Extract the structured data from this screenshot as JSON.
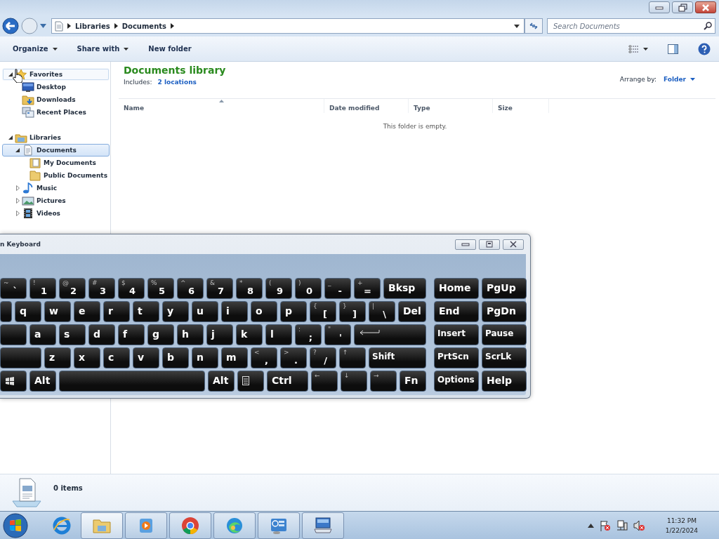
{
  "explorer": {
    "address": {
      "breadcrumbs": [
        "Libraries",
        "Documents"
      ]
    },
    "search": {
      "placeholder": "Search Documents"
    },
    "toolbar": [
      {
        "label": "Organize",
        "menu": true
      },
      {
        "label": "Share with",
        "menu": true
      },
      {
        "label": "New folder",
        "menu": false
      }
    ],
    "tree": [
      {
        "label": "Favorites",
        "expanded": true,
        "selected": false,
        "hovered": true,
        "children": [
          {
            "label": "Desktop",
            "selected": false,
            "hovered": false
          },
          {
            "label": "Downloads",
            "selected": false,
            "hovered": false
          },
          {
            "label": "Recent Places",
            "selected": false,
            "hovered": false
          }
        ]
      },
      {
        "label": "Libraries",
        "expanded": true,
        "selected": false,
        "hovered": false,
        "children": [
          {
            "label": "Documents",
            "expanded": true,
            "selected": true,
            "hovered": false,
            "children": [
              {
                "label": "My Documents",
                "selected": false,
                "hovered": false
              },
              {
                "label": "Public Documents",
                "selected": false,
                "hovered": false
              }
            ]
          },
          {
            "label": "Music",
            "expanded": false,
            "selected": false,
            "hovered": false
          },
          {
            "label": "Pictures",
            "expanded": false,
            "selected": false,
            "hovered": false
          },
          {
            "label": "Videos",
            "expanded": false,
            "selected": false,
            "hovered": false
          }
        ]
      }
    ],
    "library": {
      "title": "Documents library",
      "includes_label": "Includes:",
      "locations": "2 locations",
      "arrange_label": "Arrange by:",
      "arrange_value": "Folder"
    },
    "columns": [
      "Name",
      "Date modified",
      "Type",
      "Size"
    ],
    "empty_message": "This folder is empty.",
    "status_bar": {
      "item_count": "0 items"
    }
  },
  "keyboard": {
    "title": "n Keyboard",
    "rows": [
      {
        "keys": [
          {
            "label": "`",
            "shift": "~"
          },
          {
            "label": "1",
            "shift": "!"
          },
          {
            "label": "2",
            "shift": "@"
          },
          {
            "label": "3",
            "shift": "#"
          },
          {
            "label": "4",
            "shift": "$"
          },
          {
            "label": "5",
            "shift": "%"
          },
          {
            "label": "6",
            "shift": "^"
          },
          {
            "label": "7",
            "shift": "&"
          },
          {
            "label": "8",
            "shift": "*"
          },
          {
            "label": "9",
            "shift": "("
          },
          {
            "label": "0",
            "shift": ")"
          },
          {
            "label": "-",
            "shift": "_"
          },
          {
            "label": "=",
            "shift": "+"
          },
          {
            "label": "Bksp"
          }
        ],
        "nav_keys": [
          {
            "label": "Home"
          },
          {
            "label": "PgUp"
          }
        ]
      },
      {
        "keys": [
          {
            "kind": "blank"
          },
          {
            "label": "q"
          },
          {
            "label": "w"
          },
          {
            "label": "e"
          },
          {
            "label": "r"
          },
          {
            "label": "t"
          },
          {
            "label": "y"
          },
          {
            "label": "u"
          },
          {
            "label": "i"
          },
          {
            "label": "o"
          },
          {
            "label": "p"
          },
          {
            "label": "[",
            "shift": "{"
          },
          {
            "label": "]",
            "shift": "}"
          },
          {
            "label": "\\",
            "shift": "|"
          },
          {
            "label": "Del"
          }
        ],
        "nav_keys": [
          {
            "label": "End"
          },
          {
            "label": "PgDn"
          }
        ]
      },
      {
        "keys": [
          {
            "kind": "blank"
          },
          {
            "label": "a"
          },
          {
            "label": "s"
          },
          {
            "label": "d"
          },
          {
            "label": "f"
          },
          {
            "label": "g"
          },
          {
            "label": "h"
          },
          {
            "label": "j"
          },
          {
            "label": "k"
          },
          {
            "label": "l"
          },
          {
            "label": ";",
            "shift": ":"
          },
          {
            "label": "'",
            "shift": "\""
          },
          {
            "kind": "enter"
          }
        ],
        "nav_keys": [
          {
            "label": "Insert"
          },
          {
            "label": "Pause"
          }
        ]
      },
      {
        "keys": [
          {
            "kind": "blank"
          },
          {
            "label": "z"
          },
          {
            "label": "x"
          },
          {
            "label": "c"
          },
          {
            "label": "v"
          },
          {
            "label": "b"
          },
          {
            "label": "n"
          },
          {
            "label": "m"
          },
          {
            "label": ",",
            "shift": "<"
          },
          {
            "label": ".",
            "shift": ">"
          },
          {
            "label": "/",
            "shift": "?"
          },
          {
            "shift": "↑"
          },
          {
            "label": "Shift"
          }
        ],
        "nav_keys": [
          {
            "label": "PrtScn"
          },
          {
            "label": "ScrLk"
          }
        ]
      },
      {
        "keys": [
          {
            "kind": "logo"
          },
          {
            "label": "Alt"
          },
          {
            "kind": "blank"
          },
          {
            "label": "Alt"
          },
          {
            "kind": "menu"
          },
          {
            "label": "Ctrl"
          },
          {
            "shift": "←"
          },
          {
            "shift": "↓"
          },
          {
            "shift": "→"
          },
          {
            "label": "Fn"
          }
        ],
        "nav_keys": [
          {
            "label": "Options"
          },
          {
            "label": "Help"
          }
        ]
      }
    ]
  },
  "taskbar": {
    "apps": [
      {
        "running": false,
        "selected": false
      },
      {
        "running": true,
        "selected": true
      },
      {
        "running": true,
        "selected": false
      },
      {
        "running": true,
        "selected": false
      },
      {
        "running": true,
        "selected": false
      },
      {
        "running": true,
        "selected": false
      },
      {
        "running": true,
        "selected": false
      }
    ],
    "clock": {
      "time": "11:32 PM",
      "date": "1/22/2024"
    }
  }
}
